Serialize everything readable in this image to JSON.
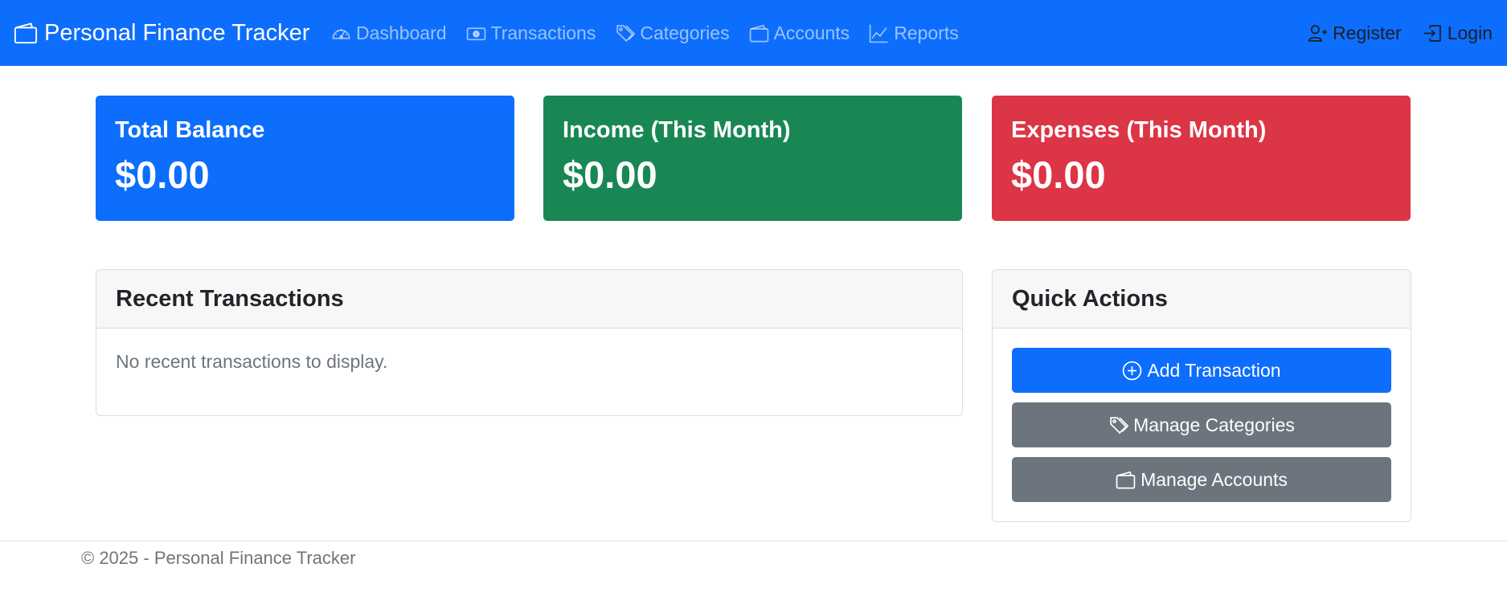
{
  "navbar": {
    "brand": "Personal Finance Tracker",
    "brand_icon": "wallet-icon",
    "links": [
      {
        "label": "Dashboard",
        "icon": "speedometer-icon"
      },
      {
        "label": "Transactions",
        "icon": "cash-icon"
      },
      {
        "label": "Categories",
        "icon": "tags-icon"
      },
      {
        "label": "Accounts",
        "icon": "wallet-icon"
      },
      {
        "label": "Reports",
        "icon": "graph-up-icon"
      }
    ],
    "register": {
      "label": "Register",
      "icon": "person-plus-icon"
    },
    "login": {
      "label": "Login",
      "icon": "box-arrow-in-right-icon"
    }
  },
  "stats": {
    "total_balance": {
      "title": "Total Balance",
      "value": "$0.00",
      "color": "#0d6efd"
    },
    "income": {
      "title": "Income (This Month)",
      "value": "$0.00",
      "color": "#198754"
    },
    "expenses": {
      "title": "Expenses (This Month)",
      "value": "$0.00",
      "color": "#dc3545"
    }
  },
  "recent_transactions": {
    "header": "Recent Transactions",
    "empty_message": "No recent transactions to display."
  },
  "quick_actions": {
    "header": "Quick Actions",
    "buttons": [
      {
        "label": "Add Transaction",
        "icon": "plus-circle-icon",
        "color": "#0d6efd"
      },
      {
        "label": "Manage Categories",
        "icon": "tags-icon",
        "color": "#6c757d"
      },
      {
        "label": "Manage Accounts",
        "icon": "wallet-icon",
        "color": "#6c757d"
      }
    ]
  },
  "footer": {
    "text": "© 2025 - Personal Finance Tracker"
  }
}
